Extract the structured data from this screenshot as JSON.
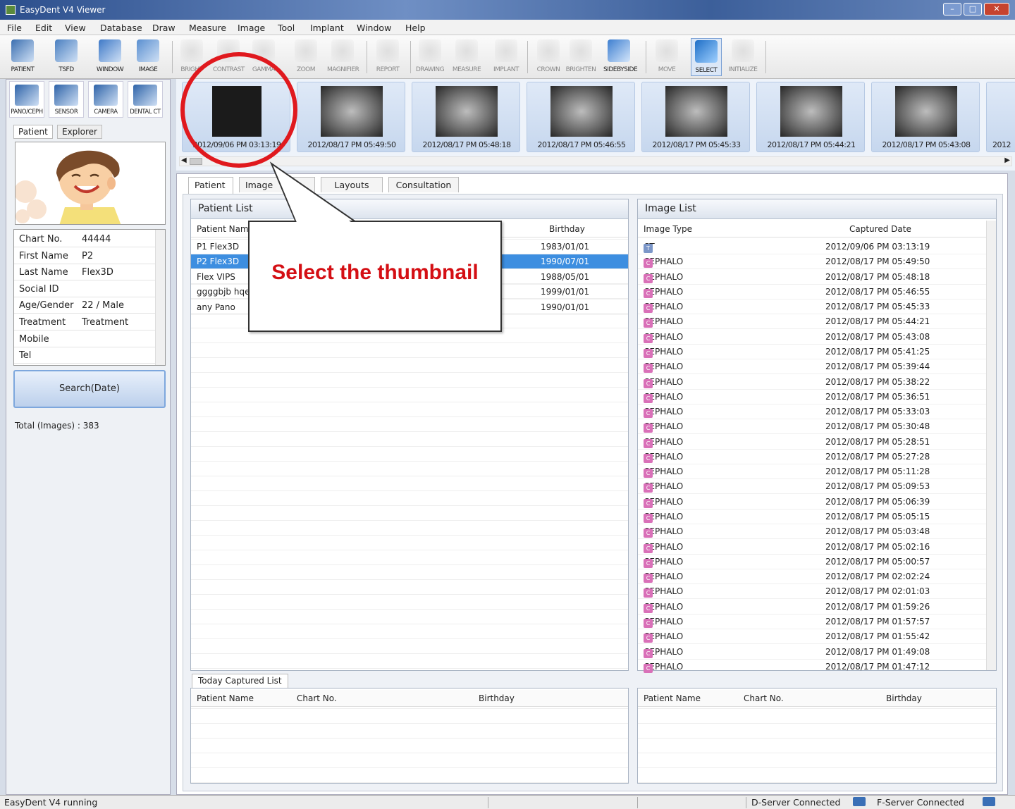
{
  "window": {
    "title": "EasyDent V4 Viewer"
  },
  "menu": [
    "File",
    "Edit",
    "View",
    "Database",
    "Draw",
    "Measure",
    "Image",
    "Tool",
    "Implant",
    "Window",
    "Help"
  ],
  "toolbar": {
    "left": [
      {
        "label": "PATIENT",
        "icon": "patient-icon",
        "color": "#3b6fb0"
      },
      {
        "label": "TSFD",
        "icon": "monitor-icon",
        "color": "#4a7fc0"
      },
      {
        "label": "WINDOW",
        "icon": "window-icon",
        "color": "#3e79c7"
      },
      {
        "label": "IMAGE",
        "icon": "image-tool-icon",
        "color": "#5a8fd0"
      }
    ],
    "right": [
      {
        "label": "BRIGHT",
        "icon": "bright-icon",
        "dim": true
      },
      {
        "label": "CONTRAST",
        "icon": "contrast-icon",
        "dim": true
      },
      {
        "label": "GAMMA",
        "icon": "gamma-icon",
        "dim": true
      },
      {
        "label": "ZOOM",
        "icon": "zoom-icon",
        "dim": true
      },
      {
        "label": "MAGNIFIER",
        "icon": "magnifier-icon",
        "dim": true
      },
      {
        "label": "REPORT",
        "icon": "report-icon",
        "dim": true
      },
      {
        "label": "DRAWING",
        "icon": "drawing-icon",
        "dim": true
      },
      {
        "label": "MEASURE",
        "icon": "measure-icon",
        "dim": true
      },
      {
        "label": "IMPLANT",
        "icon": "implant-icon",
        "dim": true
      },
      {
        "label": "CROWN",
        "icon": "crown-icon",
        "dim": true
      },
      {
        "label": "BRIGHTEN",
        "icon": "brighten-icon",
        "dim": true
      },
      {
        "label": "SIDEBYSIDE",
        "icon": "side-by-side-icon",
        "dim": false
      },
      {
        "label": "MOVE",
        "icon": "move-icon",
        "dim": true
      },
      {
        "label": "SELECT",
        "icon": "select-cursor-icon",
        "dim": false,
        "selected": true
      },
      {
        "label": "INITIALIZE",
        "icon": "initialize-icon",
        "dim": true
      }
    ]
  },
  "left_tools": [
    {
      "label": "PANO/CEPH",
      "icon": "pano-ceph-icon"
    },
    {
      "label": "SENSOR",
      "icon": "sensor-icon"
    },
    {
      "label": "CAMERA",
      "icon": "camera-icon"
    },
    {
      "label": "DENTAL CT",
      "icon": "dental-ct-icon"
    }
  ],
  "left_tabs": [
    "Patient",
    "Explorer"
  ],
  "patient_info": [
    {
      "key": "Chart No.",
      "value": "44444"
    },
    {
      "key": "First Name",
      "value": "P2"
    },
    {
      "key": "Last Name",
      "value": "Flex3D"
    },
    {
      "key": "Social ID",
      "value": ""
    },
    {
      "key": "Age/Gender",
      "value": "22 / Male"
    },
    {
      "key": "Treatment",
      "value": "Treatment"
    },
    {
      "key": "Mobile",
      "value": ""
    },
    {
      "key": "Tel",
      "value": ""
    }
  ],
  "search_button": "Search(Date)",
  "total_images": "Total (Images) : 383",
  "thumbnails": [
    "2012/09/06 PM 03:13:19",
    "2012/08/17 PM 05:49:50",
    "2012/08/17 PM 05:48:18",
    "2012/08/17 PM 05:46:55",
    "2012/08/17 PM 05:45:33",
    "2012/08/17 PM 05:44:21",
    "2012/08/17 PM 05:43:08",
    "2012"
  ],
  "content_tabs": [
    "Patient",
    "Image",
    "Layouts",
    "Consultation"
  ],
  "patient_list": {
    "title": "Patient List",
    "columns": [
      "Patient Name",
      "Birthday"
    ],
    "rows": [
      {
        "name": "P1 Flex3D",
        "birthday": "1983/01/01"
      },
      {
        "name": "P2 Flex3D",
        "birthday": "1990/07/01",
        "selected": true
      },
      {
        "name": "Flex VIPS",
        "birthday": "1988/05/01"
      },
      {
        "name": "ggggbjb hqe",
        "birthday": "1999/01/01"
      },
      {
        "name": "any Pano",
        "birthday": "1990/01/01"
      }
    ]
  },
  "image_list": {
    "title": "Image List",
    "columns": [
      "Image Type",
      "Captured Date"
    ],
    "rows": [
      {
        "type": "CT",
        "date": "2012/09/06 PM 03:13:19",
        "kind": "ct"
      },
      {
        "type": "CEPHALO",
        "date": "2012/08/17 PM 05:49:50"
      },
      {
        "type": "CEPHALO",
        "date": "2012/08/17 PM 05:48:18"
      },
      {
        "type": "CEPHALO",
        "date": "2012/08/17 PM 05:46:55"
      },
      {
        "type": "CEPHALO",
        "date": "2012/08/17 PM 05:45:33"
      },
      {
        "type": "CEPHALO",
        "date": "2012/08/17 PM 05:44:21"
      },
      {
        "type": "CEPHALO",
        "date": "2012/08/17 PM 05:43:08"
      },
      {
        "type": "CEPHALO",
        "date": "2012/08/17 PM 05:41:25"
      },
      {
        "type": "CEPHALO",
        "date": "2012/08/17 PM 05:39:44"
      },
      {
        "type": "CEPHALO",
        "date": "2012/08/17 PM 05:38:22"
      },
      {
        "type": "CEPHALO",
        "date": "2012/08/17 PM 05:36:51"
      },
      {
        "type": "CEPHALO",
        "date": "2012/08/17 PM 05:33:03"
      },
      {
        "type": "CEPHALO",
        "date": "2012/08/17 PM 05:30:48"
      },
      {
        "type": "CEPHALO",
        "date": "2012/08/17 PM 05:28:51"
      },
      {
        "type": "CEPHALO",
        "date": "2012/08/17 PM 05:27:28"
      },
      {
        "type": "CEPHALO",
        "date": "2012/08/17 PM 05:11:28"
      },
      {
        "type": "CEPHALO",
        "date": "2012/08/17 PM 05:09:53"
      },
      {
        "type": "CEPHALO",
        "date": "2012/08/17 PM 05:06:39"
      },
      {
        "type": "CEPHALO",
        "date": "2012/08/17 PM 05:05:15"
      },
      {
        "type": "CEPHALO",
        "date": "2012/08/17 PM 05:03:48"
      },
      {
        "type": "CEPHALO",
        "date": "2012/08/17 PM 05:02:16"
      },
      {
        "type": "CEPHALO",
        "date": "2012/08/17 PM 05:00:57"
      },
      {
        "type": "CEPHALO",
        "date": "2012/08/17 PM 02:02:24"
      },
      {
        "type": "CEPHALO",
        "date": "2012/08/17 PM 02:01:03"
      },
      {
        "type": "CEPHALO",
        "date": "2012/08/17 PM 01:59:26"
      },
      {
        "type": "CEPHALO",
        "date": "2012/08/17 PM 01:57:57"
      },
      {
        "type": "CEPHALO",
        "date": "2012/08/17 PM 01:55:42"
      },
      {
        "type": "CEPHALO",
        "date": "2012/08/17 PM 01:49:08"
      },
      {
        "type": "CEPHALO",
        "date": "2012/08/17 PM 01:47:12"
      }
    ]
  },
  "today_list": {
    "tab": "Today Captured List",
    "columns": [
      "Patient Name",
      "Chart No.",
      "Birthday"
    ]
  },
  "right_bottom_list": {
    "columns": [
      "Patient Name",
      "Chart No.",
      "Birthday"
    ]
  },
  "callout": {
    "text": "Select the thumbnail",
    "ring_color": "#e0191e",
    "text_color": "#d40f14"
  },
  "status": {
    "left": "EasyDent V4 running",
    "d_server": "D-Server Connected",
    "f_server": "F-Server Connected"
  }
}
